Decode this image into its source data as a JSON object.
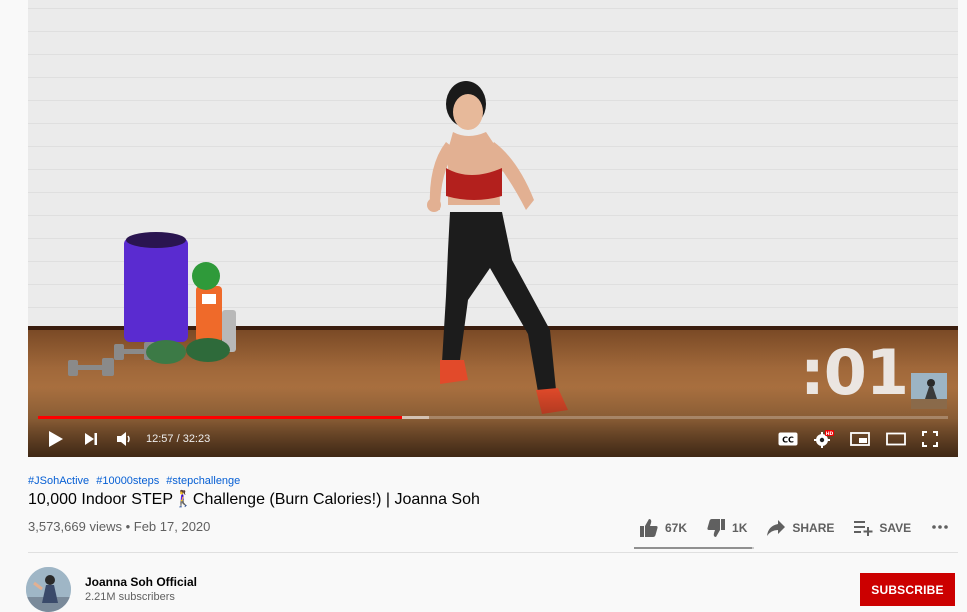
{
  "player": {
    "overlay_timer": ":01",
    "time_display": "12:57 / 32:23",
    "played_fraction": 0.4,
    "loaded_fraction": 0.43,
    "hd_badge": "HD",
    "controls": {
      "play": "play-icon",
      "next": "next-icon",
      "volume": "volume-icon",
      "captions": "CC",
      "settings": "gear-icon",
      "miniplayer": "miniplayer-icon",
      "theater": "theater-icon",
      "fullscreen": "fullscreen-icon"
    }
  },
  "video": {
    "hashtags": [
      "#JSohActive",
      "#10000steps",
      "#stepchallenge"
    ],
    "title": "10,000 Indoor STEP🚶‍♀️Challenge (Burn Calories!) | Joanna Soh",
    "views": "3,573,669 views",
    "date": "Feb 17, 2020",
    "meta_separator": "•",
    "likes": "67K",
    "dislikes": "1K",
    "share_label": "SHARE",
    "save_label": "SAVE",
    "like_ratio": 0.985
  },
  "channel": {
    "name": "Joanna Soh Official",
    "subscribers": "2.21M subscribers",
    "subscribe_label": "SUBSCRIBE"
  },
  "colors": {
    "accent": "#ff0000",
    "subscribe_bg": "#cc0000",
    "hashtag": "#065fd4"
  }
}
